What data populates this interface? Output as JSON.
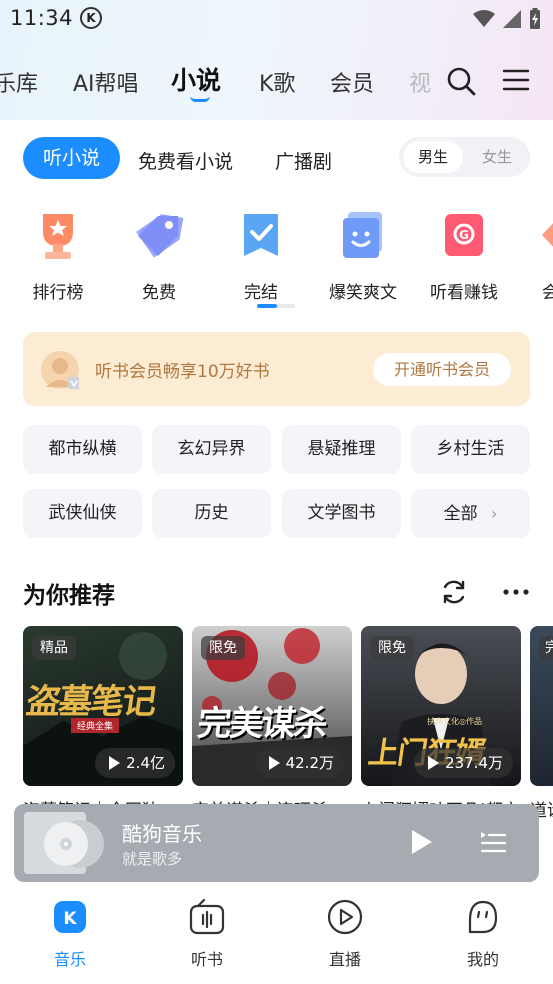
{
  "status": {
    "time": "11:34",
    "app_badge": "K"
  },
  "top_nav": {
    "tabs": [
      "乐库",
      "AI帮唱",
      "小说",
      "K歌",
      "会员",
      "视"
    ],
    "active_tab": "小说"
  },
  "sub_tabs": {
    "active": "听小说",
    "others": [
      "免费看小说",
      "广播剧"
    ],
    "gender": {
      "selected": "男生",
      "other": "女生"
    }
  },
  "categories": [
    {
      "label": "排行榜",
      "icon": "trophy-icon",
      "color": "#ff8a66"
    },
    {
      "label": "免费",
      "icon": "tag-icon",
      "color": "#7f8ff7"
    },
    {
      "label": "完结",
      "icon": "bookmark-check-icon",
      "color": "#5aa6f5"
    },
    {
      "label": "爆笑爽文",
      "icon": "smile-card-icon",
      "color": "#6f9af8"
    },
    {
      "label": "听看赚钱",
      "icon": "coin-icon",
      "color": "#ff5a73"
    },
    {
      "label": "会",
      "icon": "partial-icon",
      "color": "#ff9b80"
    }
  ],
  "member_banner": {
    "text": "听书会员畅享10万好书",
    "button": "开通听书会员"
  },
  "genres": [
    "都市纵横",
    "玄幻异界",
    "悬疑推理",
    "乡村生活",
    "武侠仙侠",
    "历史",
    "文学图书",
    "全部"
  ],
  "recommend": {
    "title": "为你推荐",
    "books": [
      {
        "badge": "精品",
        "plays": "2.4亿",
        "title": "盗墓笔记｜全网独",
        "cover_text": "盗墓笔记",
        "cover_sub": "经典全集"
      },
      {
        "badge": "限免",
        "plays": "42.2万",
        "title": "完美谋杀｜连环杀",
        "cover_text": "完美谋杀",
        "cover_sub": ""
      },
      {
        "badge": "限免",
        "plays": "237.4万",
        "title": "上门狂婿叶不凡|都市",
        "cover_text": "上门狂婿",
        "cover_sub": "扶声文化◎作品"
      },
      {
        "badge": "完",
        "plays": "",
        "title": "道诡",
        "cover_text": "",
        "cover_sub": ""
      }
    ]
  },
  "mini_player": {
    "title": "酷狗音乐",
    "subtitle": "就是歌多"
  },
  "bottom_nav": {
    "items": [
      {
        "label": "音乐",
        "icon": "kugou-k-icon",
        "active": true
      },
      {
        "label": "听书",
        "icon": "radio-icon",
        "active": false
      },
      {
        "label": "直播",
        "icon": "live-play-icon",
        "active": false
      },
      {
        "label": "我的",
        "icon": "profile-face-icon",
        "active": false
      }
    ]
  },
  "colors": {
    "accent": "#1c8dff",
    "member_bg": "#fdecd4",
    "member_text": "#b0773e"
  }
}
